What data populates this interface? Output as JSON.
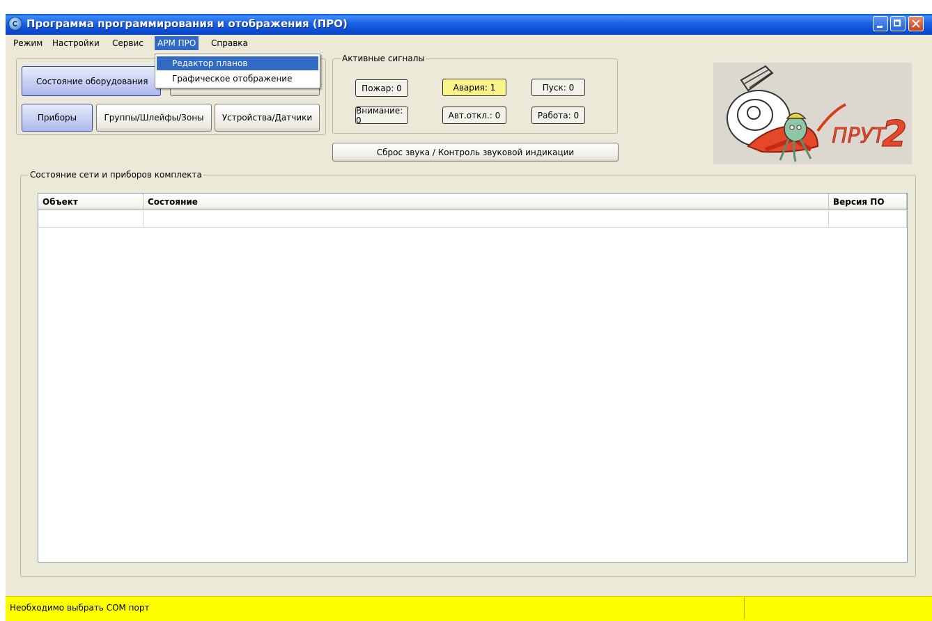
{
  "window": {
    "title": "Программа программирования и отображения (ПРО)"
  },
  "menu": {
    "items": [
      "Режим",
      "Настройки",
      "Сервис",
      "АРМ ПРО",
      "Справка"
    ],
    "active_index": 3,
    "dropdown": [
      "Редактор планов",
      "Графическое отображение"
    ]
  },
  "left_panel": {
    "equipment_state_label": "Состояние оборудования",
    "tabs": [
      "Приборы",
      "Группы/Шлейфы/Зоны",
      "Устройства/Датчики"
    ]
  },
  "signals": {
    "legend": "Активные сигналы",
    "fire": "Пожар: 0",
    "alarm": "Авария: 1",
    "start": "Пуск: 0",
    "attention": "Внимание: 0",
    "auto_off": "Авт.откл.: 0",
    "work": "Работа: 0",
    "reset_sound_label": "Сброс звука / Контроль  звуковой индикации"
  },
  "network": {
    "legend": "Состояние сети и приборов комплекта",
    "columns": [
      "Объект",
      "Состояние",
      "Версия ПО"
    ]
  },
  "status": {
    "message": "Необходимо выбрать COM порт"
  },
  "colors": {
    "titlebar": "#0a5fe0",
    "menu_highlight": "#316ac5",
    "alarm": "#fbf38a",
    "statusbar": "#ffff00"
  }
}
